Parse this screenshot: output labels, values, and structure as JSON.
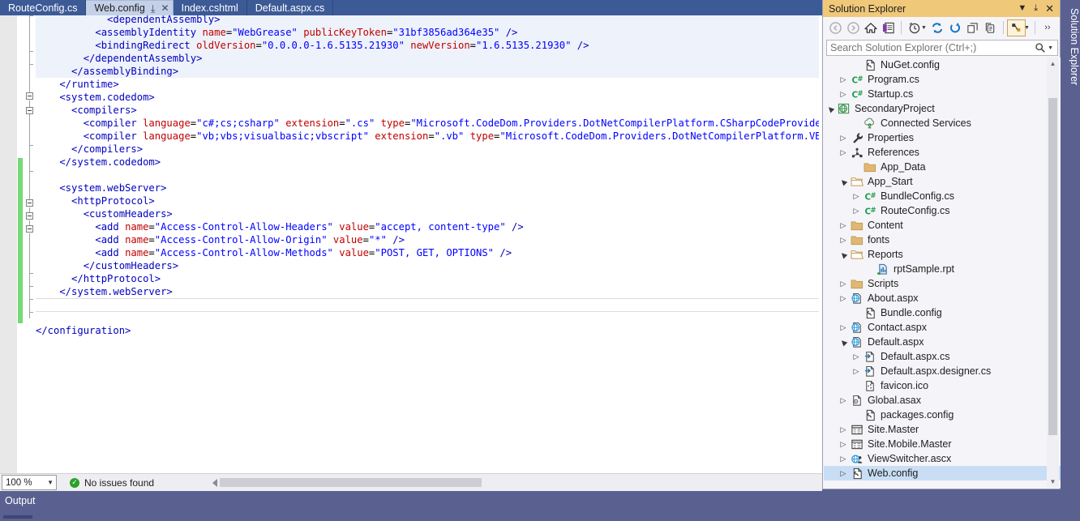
{
  "window": {
    "theme_accent": "#3c5a96",
    "chrome_bg": "#5a6191"
  },
  "tabs": [
    {
      "label": "RouteConfig.cs",
      "active": false
    },
    {
      "label": "Web.config",
      "active": true,
      "pin_icon": "pin-icon",
      "close_icon": "close-icon"
    },
    {
      "label": "Index.cshtml",
      "active": false
    },
    {
      "label": "Default.aspx.cs",
      "active": false
    }
  ],
  "editor": {
    "lines": [
      {
        "indent": 0,
        "segments": [
          {
            "t": "tg",
            "v": "            <dependentAssembly>"
          }
        ],
        "selected": true
      },
      {
        "indent": 0,
        "segments": [
          {
            "t": "tg",
            "v": "          <assemblyIdentity "
          },
          {
            "t": "at",
            "v": "name"
          },
          {
            "t": "pl",
            "v": "="
          },
          {
            "t": "vl",
            "v": "\"WebGrease\""
          },
          {
            "t": "pl",
            "v": " "
          },
          {
            "t": "at",
            "v": "publicKeyToken"
          },
          {
            "t": "pl",
            "v": "="
          },
          {
            "t": "vl",
            "v": "\"31bf3856ad364e35\""
          },
          {
            "t": "tg",
            "v": " />"
          }
        ],
        "selected": true
      },
      {
        "indent": 0,
        "segments": [
          {
            "t": "tg",
            "v": "          <bindingRedirect "
          },
          {
            "t": "at",
            "v": "oldVersion"
          },
          {
            "t": "pl",
            "v": "="
          },
          {
            "t": "vl",
            "v": "\"0.0.0.0-1.6.5135.21930\""
          },
          {
            "t": "pl",
            "v": " "
          },
          {
            "t": "at",
            "v": "newVersion"
          },
          {
            "t": "pl",
            "v": "="
          },
          {
            "t": "vl",
            "v": "\"1.6.5135.21930\""
          },
          {
            "t": "tg",
            "v": " />"
          }
        ],
        "selected": true
      },
      {
        "indent": 0,
        "segments": [
          {
            "t": "tg",
            "v": "        </dependentAssembly>"
          }
        ],
        "selected": true
      },
      {
        "indent": 0,
        "segments": [
          {
            "t": "tg",
            "v": "      </assemblyBinding>"
          }
        ],
        "selected": true
      },
      {
        "indent": 0,
        "segments": [
          {
            "t": "tg",
            "v": "    </runtime>"
          }
        ],
        "selected": false
      },
      {
        "indent": 0,
        "segments": [
          {
            "t": "tg",
            "v": "    <system.codedom>"
          }
        ],
        "selected": false
      },
      {
        "indent": 0,
        "segments": [
          {
            "t": "tg",
            "v": "      <compilers>"
          }
        ],
        "selected": false
      },
      {
        "indent": 0,
        "segments": [
          {
            "t": "tg",
            "v": "        <compiler "
          },
          {
            "t": "at",
            "v": "language"
          },
          {
            "t": "pl",
            "v": "="
          },
          {
            "t": "vl",
            "v": "\"c#;cs;csharp\""
          },
          {
            "t": "pl",
            "v": " "
          },
          {
            "t": "at",
            "v": "extension"
          },
          {
            "t": "pl",
            "v": "="
          },
          {
            "t": "vl",
            "v": "\".cs\""
          },
          {
            "t": "pl",
            "v": " "
          },
          {
            "t": "at",
            "v": "type"
          },
          {
            "t": "pl",
            "v": "="
          },
          {
            "t": "vl",
            "v": "\"Microsoft.CodeDom.Providers.DotNetCompilerPlatform.CSharpCodeProvider, Micros"
          }
        ],
        "selected": false
      },
      {
        "indent": 0,
        "segments": [
          {
            "t": "tg",
            "v": "        <compiler "
          },
          {
            "t": "at",
            "v": "language"
          },
          {
            "t": "pl",
            "v": "="
          },
          {
            "t": "vl",
            "v": "\"vb;vbs;visualbasic;vbscript\""
          },
          {
            "t": "pl",
            "v": " "
          },
          {
            "t": "at",
            "v": "extension"
          },
          {
            "t": "pl",
            "v": "="
          },
          {
            "t": "vl",
            "v": "\".vb\""
          },
          {
            "t": "pl",
            "v": " "
          },
          {
            "t": "at",
            "v": "type"
          },
          {
            "t": "pl",
            "v": "="
          },
          {
            "t": "vl",
            "v": "\"Microsoft.CodeDom.Providers.DotNetCompilerPlatform.VBCodeProvi"
          }
        ],
        "selected": false
      },
      {
        "indent": 0,
        "segments": [
          {
            "t": "tg",
            "v": "      </compilers>"
          }
        ],
        "selected": false
      },
      {
        "indent": 0,
        "segments": [
          {
            "t": "tg",
            "v": "    </system.codedom>"
          }
        ],
        "selected": false
      },
      {
        "indent": 0,
        "segments": [
          {
            "t": "pl",
            "v": ""
          }
        ],
        "selected": false
      },
      {
        "indent": 0,
        "segments": [
          {
            "t": "tg",
            "v": "    <system.webServer>"
          }
        ],
        "selected": false
      },
      {
        "indent": 0,
        "segments": [
          {
            "t": "tg",
            "v": "      <httpProtocol>"
          }
        ],
        "selected": false
      },
      {
        "indent": 0,
        "segments": [
          {
            "t": "tg",
            "v": "        <customHeaders>"
          }
        ],
        "selected": false
      },
      {
        "indent": 0,
        "segments": [
          {
            "t": "tg",
            "v": "          <add "
          },
          {
            "t": "at",
            "v": "name"
          },
          {
            "t": "pl",
            "v": "="
          },
          {
            "t": "vl",
            "v": "\"Access-Control-Allow-Headers\""
          },
          {
            "t": "pl",
            "v": " "
          },
          {
            "t": "at",
            "v": "value"
          },
          {
            "t": "pl",
            "v": "="
          },
          {
            "t": "vl",
            "v": "\"accept, content-type\""
          },
          {
            "t": "tg",
            "v": " />"
          }
        ],
        "selected": false
      },
      {
        "indent": 0,
        "segments": [
          {
            "t": "tg",
            "v": "          <add "
          },
          {
            "t": "at",
            "v": "name"
          },
          {
            "t": "pl",
            "v": "="
          },
          {
            "t": "vl",
            "v": "\"Access-Control-Allow-Origin\""
          },
          {
            "t": "pl",
            "v": " "
          },
          {
            "t": "at",
            "v": "value"
          },
          {
            "t": "pl",
            "v": "="
          },
          {
            "t": "vl",
            "v": "\"*\""
          },
          {
            "t": "tg",
            "v": " />"
          }
        ],
        "selected": false
      },
      {
        "indent": 0,
        "segments": [
          {
            "t": "tg",
            "v": "          <add "
          },
          {
            "t": "at",
            "v": "name"
          },
          {
            "t": "pl",
            "v": "="
          },
          {
            "t": "vl",
            "v": "\"Access-Control-Allow-Methods\""
          },
          {
            "t": "pl",
            "v": " "
          },
          {
            "t": "at",
            "v": "value"
          },
          {
            "t": "pl",
            "v": "="
          },
          {
            "t": "vl",
            "v": "\"POST, GET, OPTIONS\""
          },
          {
            "t": "tg",
            "v": " />"
          }
        ],
        "selected": false
      },
      {
        "indent": 0,
        "segments": [
          {
            "t": "tg",
            "v": "        </customHeaders>"
          }
        ],
        "selected": false
      },
      {
        "indent": 0,
        "segments": [
          {
            "t": "tg",
            "v": "      </httpProtocol>"
          }
        ],
        "selected": false
      },
      {
        "indent": 0,
        "segments": [
          {
            "t": "tg",
            "v": "    </system.webServer>"
          }
        ],
        "selected": false
      },
      {
        "indent": 0,
        "segments": [
          {
            "t": "pl",
            "v": ""
          }
        ],
        "selected": false
      },
      {
        "indent": 0,
        "segments": [
          {
            "t": "pl",
            "v": ""
          }
        ],
        "selected": false
      },
      {
        "indent": 0,
        "segments": [
          {
            "t": "tg",
            "v": "</configuration>"
          }
        ],
        "selected": false
      }
    ]
  },
  "status": {
    "zoom": "100 %",
    "issues": "No issues found",
    "ok_icon": "check-circle-icon"
  },
  "output": {
    "title": "Output"
  },
  "solution_explorer": {
    "title": "Solution Explorer",
    "vertical_tab_label": "Solution Explorer",
    "titlebar_buttons": [
      {
        "name": "dropdown-caret-icon",
        "glyph": "▼"
      },
      {
        "name": "pin-icon",
        "glyph": "⤒"
      },
      {
        "name": "close-icon",
        "glyph": "✕"
      }
    ],
    "toolbar": [
      {
        "name": "back-icon"
      },
      {
        "name": "forward-icon"
      },
      {
        "name": "home-icon"
      },
      {
        "name": "solution-explorer-view-icon"
      },
      {
        "name": "separator"
      },
      {
        "name": "pending-changes-icon",
        "has_caret": true
      },
      {
        "name": "refresh-icon"
      },
      {
        "name": "sync-icon"
      },
      {
        "name": "collapse-all-icon"
      },
      {
        "name": "show-all-files-icon"
      },
      {
        "name": "separator"
      },
      {
        "name": "properties-icon",
        "framed": true,
        "has_caret": true
      },
      {
        "name": "overflow-icon"
      }
    ],
    "search": {
      "placeholder": "Search Solution Explorer (Ctrl+;)",
      "value": "",
      "icon": "magnifier-icon",
      "caret": "dropdown-caret-icon"
    },
    "tree": [
      {
        "label": "NuGet.config",
        "depth": 3,
        "expander": "none",
        "icon": "config-file-icon",
        "selected": false
      },
      {
        "label": "Program.cs",
        "depth": 2,
        "expander": "collapsed",
        "icon": "csharp-icon",
        "selected": false
      },
      {
        "label": "Startup.cs",
        "depth": 2,
        "expander": "collapsed",
        "icon": "csharp-icon",
        "selected": false
      },
      {
        "label": "SecondaryProject",
        "depth": 1,
        "expander": "expanded",
        "icon": "web-project-icon",
        "selected": false
      },
      {
        "label": "Connected Services",
        "depth": 3,
        "expander": "none",
        "icon": "connected-services-icon",
        "selected": false
      },
      {
        "label": "Properties",
        "depth": 2,
        "expander": "collapsed",
        "icon": "wrench-icon",
        "selected": false
      },
      {
        "label": "References",
        "depth": 2,
        "expander": "collapsed",
        "icon": "references-icon",
        "selected": false
      },
      {
        "label": "App_Data",
        "depth": 3,
        "expander": "none",
        "icon": "folder-closed-icon",
        "selected": false
      },
      {
        "label": "App_Start",
        "depth": 2,
        "expander": "expanded",
        "icon": "folder-open-icon",
        "selected": false
      },
      {
        "label": "BundleConfig.cs",
        "depth": 3,
        "expander": "collapsed",
        "icon": "csharp-icon",
        "selected": false
      },
      {
        "label": "RouteConfig.cs",
        "depth": 3,
        "expander": "collapsed",
        "icon": "csharp-icon",
        "selected": false
      },
      {
        "label": "Content",
        "depth": 2,
        "expander": "collapsed",
        "icon": "folder-closed-icon",
        "selected": false
      },
      {
        "label": "fonts",
        "depth": 2,
        "expander": "collapsed",
        "icon": "folder-closed-icon",
        "selected": false
      },
      {
        "label": "Reports",
        "depth": 2,
        "expander": "expanded",
        "icon": "folder-open-icon",
        "selected": false
      },
      {
        "label": "rptSample.rpt",
        "depth": 4,
        "expander": "none",
        "icon": "report-icon",
        "selected": false
      },
      {
        "label": "Scripts",
        "depth": 2,
        "expander": "collapsed",
        "icon": "folder-closed-icon",
        "selected": false
      },
      {
        "label": "About.aspx",
        "depth": 2,
        "expander": "collapsed",
        "icon": "aspx-icon",
        "selected": false
      },
      {
        "label": "Bundle.config",
        "depth": 3,
        "expander": "none",
        "icon": "config-file-icon",
        "selected": false
      },
      {
        "label": "Contact.aspx",
        "depth": 2,
        "expander": "collapsed",
        "icon": "aspx-icon",
        "selected": false
      },
      {
        "label": "Default.aspx",
        "depth": 2,
        "expander": "expanded",
        "icon": "aspx-icon",
        "selected": false
      },
      {
        "label": "Default.aspx.cs",
        "depth": 3,
        "expander": "collapsed",
        "icon": "codebehind-icon",
        "selected": false
      },
      {
        "label": "Default.aspx.designer.cs",
        "depth": 3,
        "expander": "collapsed",
        "icon": "codebehind-icon",
        "selected": false
      },
      {
        "label": "favicon.ico",
        "depth": 3,
        "expander": "none",
        "icon": "icon-file-icon",
        "selected": false
      },
      {
        "label": "Global.asax",
        "depth": 2,
        "expander": "collapsed",
        "icon": "asax-icon",
        "selected": false
      },
      {
        "label": "packages.config",
        "depth": 3,
        "expander": "none",
        "icon": "config-file-icon",
        "selected": false
      },
      {
        "label": "Site.Master",
        "depth": 2,
        "expander": "collapsed",
        "icon": "master-page-icon",
        "selected": false
      },
      {
        "label": "Site.Mobile.Master",
        "depth": 2,
        "expander": "collapsed",
        "icon": "master-page-icon",
        "selected": false
      },
      {
        "label": "ViewSwitcher.ascx",
        "depth": 2,
        "expander": "collapsed",
        "icon": "ascx-icon",
        "selected": false
      },
      {
        "label": "Web.config",
        "depth": 2,
        "expander": "collapsed",
        "icon": "config-file-icon",
        "selected": true
      }
    ]
  }
}
